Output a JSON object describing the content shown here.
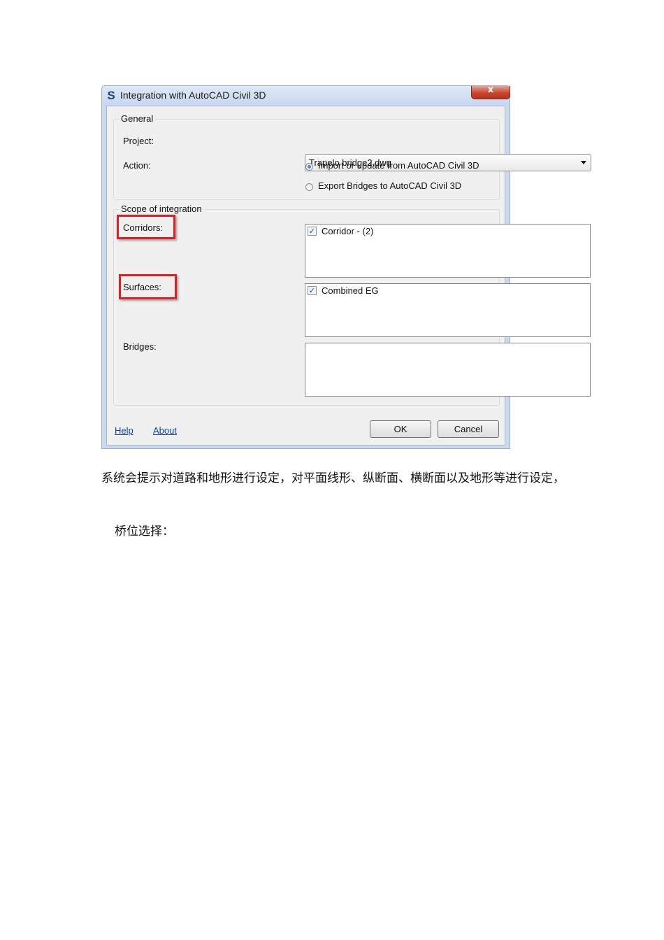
{
  "dialog": {
    "app_icon": "S",
    "title": "Integration with AutoCAD Civil 3D",
    "close_label": "x",
    "general": {
      "group_label": "General",
      "project_label": "Project:",
      "project_value": "Trapelo bridge2.dwg",
      "action_label": "Action:",
      "actions": [
        {
          "label": "Import or update from AutoCAD Civil 3D",
          "selected": true
        },
        {
          "label": "Export Bridges to AutoCAD Civil 3D",
          "selected": false
        }
      ]
    },
    "scope": {
      "group_label": "Scope of integration",
      "corridors_label": "Corridors:",
      "corridor_items": [
        {
          "label": "Corridor - (2)",
          "checked": true
        }
      ],
      "surfaces_label": "Surfaces:",
      "surface_items": [
        {
          "label": "Combined EG",
          "checked": true
        }
      ],
      "bridges_label": "Bridges:",
      "bridge_items": []
    },
    "footer": {
      "help": "Help",
      "about": "About",
      "ok": "OK",
      "cancel": "Cancel"
    },
    "highlight_color": "#dd1f26"
  },
  "document": {
    "paragraph": "系统会提示对道路和地形进行设定，对平面线形、纵断面、横断面以及地形等进行设定，",
    "heading": "桥位选择："
  }
}
